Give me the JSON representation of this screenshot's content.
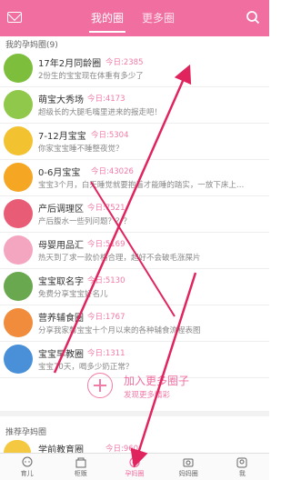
{
  "header": {
    "tabs": [
      {
        "label": "我的圈"
      },
      {
        "label": "更多圈"
      }
    ]
  },
  "my_circles": {
    "title": "我的孕妈圈(9)",
    "items": [
      {
        "name": "17年2月同龄圈",
        "today": "今日:2385",
        "desc": "2份生的宝宝现在体重有多少了",
        "avatar": "number-2-avatar-icon",
        "color": "#7dbf3c"
      },
      {
        "name": "萌宝大秀场",
        "today": "今日:4173",
        "desc": "超级长的大腿毛嘴里进来的报走吧！",
        "avatar": "baby-face-avatar-icon",
        "color": "#8fc84a"
      },
      {
        "name": "7-12月宝宝",
        "today": "今日:5304",
        "desc": "你家宝宝睡不睡整夜觉？",
        "avatar": "baby-bottle-avatar-icon",
        "color": "#f2c230"
      },
      {
        "name": "0-6月宝宝",
        "today": "今日:43026",
        "desc": "宝宝3个月，白天睡觉就要抱着才能睡的踏实，一放下床上…",
        "avatar": "sleeping-baby-avatar-icon",
        "color": "#f5a623"
      },
      {
        "name": "产后调理区",
        "today": "今日:7521",
        "desc": "产后腹水一些列问题？？？",
        "avatar": "mother-avatar-icon",
        "color": "#e85d75"
      },
      {
        "name": "母婴用品汇",
        "today": "今日:5169",
        "desc": "热天到了求一款价格合理，超好不会破毛涨屎片",
        "avatar": "stroller-avatar-icon",
        "color": "#f4a6c0"
      },
      {
        "name": "宝宝取名字",
        "today": "今日:5130",
        "desc": "免费分享宝宝好名儿",
        "avatar": "name-book-avatar-icon",
        "color": "#6aa84f"
      },
      {
        "name": "营养辅食圈",
        "today": "今日:1767",
        "desc": "分享我家馨宝宝十个月以来的各种辅食流程表图",
        "avatar": "food-bowl-avatar-icon",
        "color": "#f08c3c"
      },
      {
        "name": "宝宝早教圈",
        "today": "今日:1311",
        "desc": "宝宝70天，喝多少奶正常？",
        "avatar": "duck-toy-avatar-icon",
        "color": "#4a90d9"
      }
    ]
  },
  "add_more": {
    "title": "加入更多圈子",
    "subtitle": "发现更多精彩"
  },
  "recommended": {
    "title": "推荐孕妈圈",
    "item": {
      "name": "学前教育圈",
      "today": "今日:960"
    }
  },
  "bottom_nav": [
    {
      "label": "育儿",
      "icon": "baby-icon"
    },
    {
      "label": "柜贩",
      "icon": "shop-icon"
    },
    {
      "label": "孕妈圈",
      "icon": "circle-icon",
      "active": true
    },
    {
      "label": "妈妈圈",
      "icon": "camera-icon"
    },
    {
      "label": "我",
      "icon": "person-icon"
    }
  ],
  "colors": {
    "accent": "#f06ea0",
    "today_text": "#f27aa7",
    "arrow": "#e0245e"
  }
}
